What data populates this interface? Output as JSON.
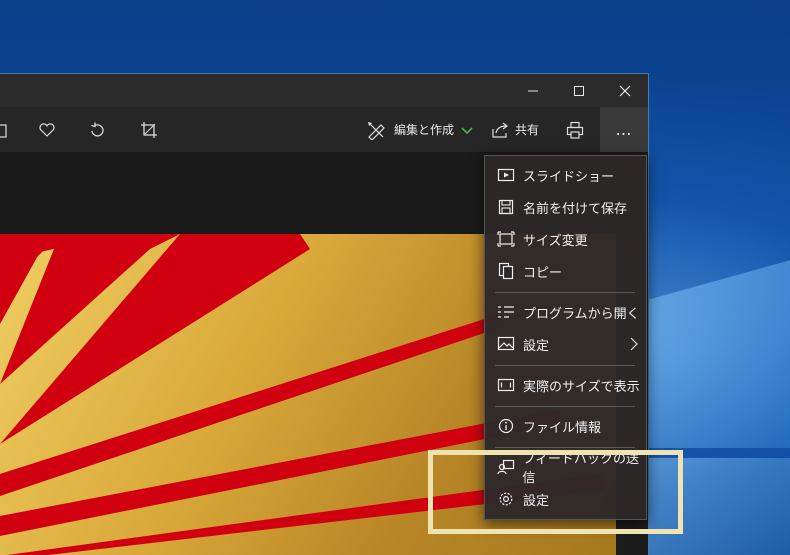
{
  "toolbar": {
    "edit_create_label": "編集と作成",
    "share_label": "共有",
    "more_label": "…"
  },
  "menu": {
    "items": [
      {
        "label": "スライドショー",
        "icon": "slideshow-icon"
      },
      {
        "label": "名前を付けて保存",
        "icon": "save-icon"
      },
      {
        "label": "サイズ変更",
        "icon": "resize-icon"
      },
      {
        "label": "コピー",
        "icon": "copy-icon"
      },
      {
        "label": "プログラムから開く",
        "icon": "open-with-icon"
      },
      {
        "label": "設定",
        "icon": "picture-settings-icon"
      },
      {
        "label": "実際のサイズで表示",
        "icon": "actual-size-icon"
      },
      {
        "label": "ファイル情報",
        "icon": "info-icon"
      },
      {
        "label": "フィードバックの送信",
        "icon": "feedback-icon"
      },
      {
        "label": "設定",
        "icon": "gear-icon"
      }
    ]
  },
  "colors": {
    "accent_green": "#4caf50",
    "highlight": "#efe3b2",
    "flag_red": "#d10010",
    "gold": "#d9a93a"
  }
}
